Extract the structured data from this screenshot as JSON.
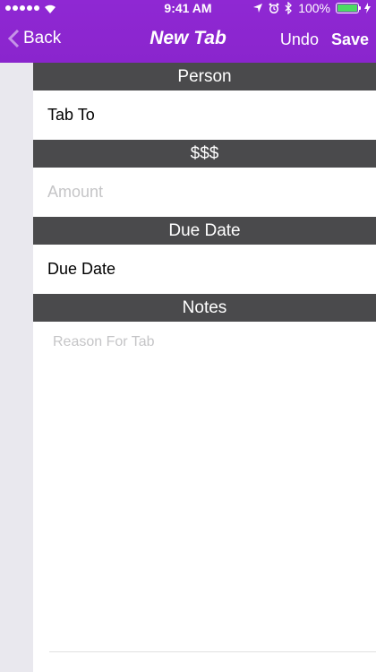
{
  "status_bar": {
    "time": "9:41 AM",
    "battery": "100%",
    "battery_level": 1.0
  },
  "nav": {
    "back_label": "Back",
    "title": "New Tab",
    "undo_label": "Undo",
    "save_label": "Save"
  },
  "form": {
    "sections": [
      {
        "header": "Person",
        "value": "Tab To",
        "is_placeholder": false
      },
      {
        "header": "$$$",
        "value": "Amount",
        "is_placeholder": true
      },
      {
        "header": "Due Date",
        "value": "Due Date",
        "is_placeholder": false
      },
      {
        "header": "Notes",
        "value": "Reason For Tab",
        "is_placeholder": true
      }
    ]
  },
  "colors": {
    "nav_bar": "#8f28d3",
    "section_header": "#4a4a4c",
    "placeholder_text": "#c5c5c7"
  }
}
